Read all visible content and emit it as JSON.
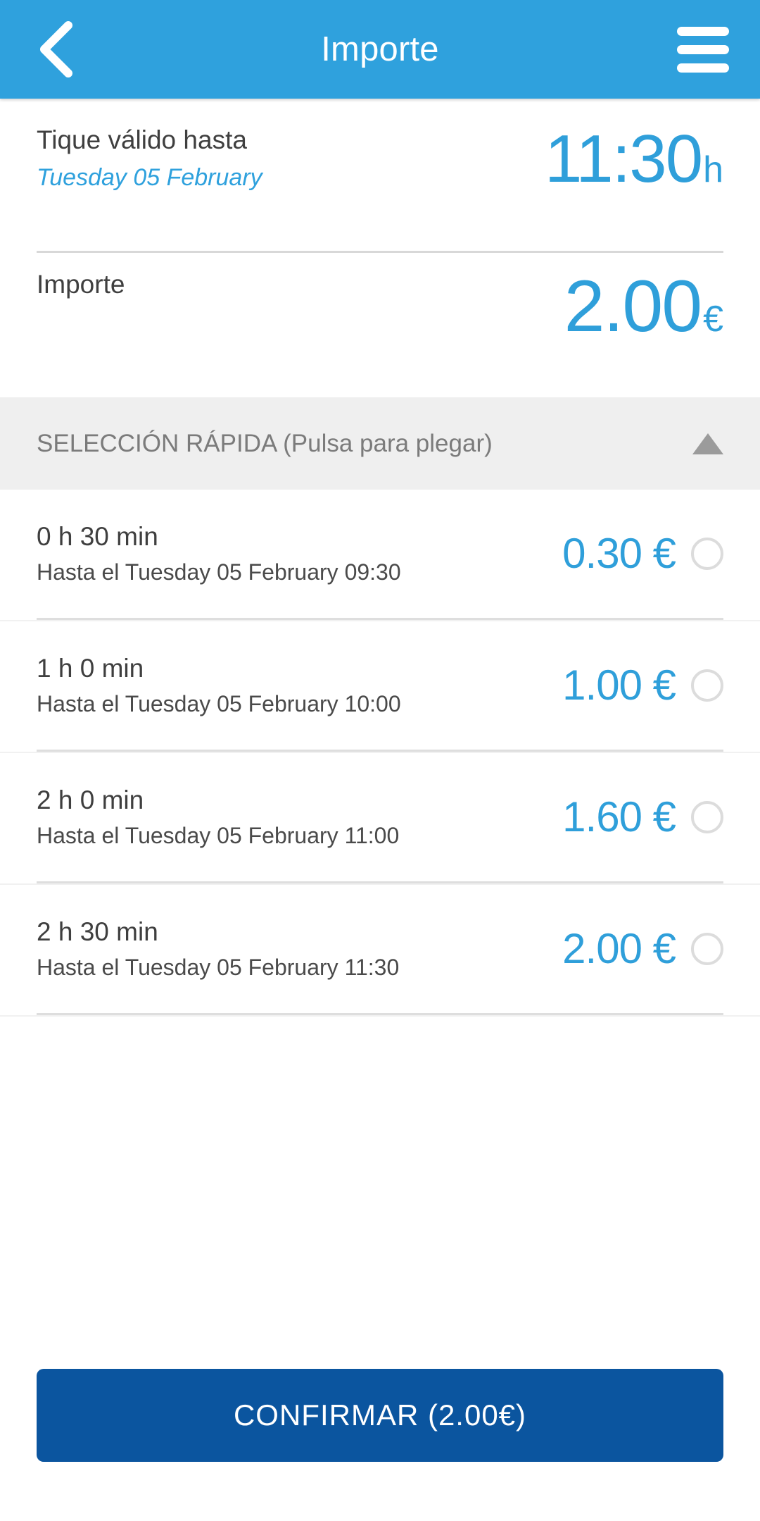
{
  "appbar": {
    "title": "Importe",
    "back_icon": "chevron-left-icon",
    "menu_icon": "hamburger-menu-icon",
    "background_color": "#2fa1dd"
  },
  "summary": {
    "validity": {
      "label": "Tique válido hasta",
      "date": "Tuesday 05 February",
      "time": "11:30",
      "time_unit": "h"
    },
    "amount": {
      "label": "Importe",
      "value": "2.00",
      "currency": "€"
    }
  },
  "quick_select": {
    "header_label": "SELECCIÓN RÁPIDA (Pulsa para plegar)",
    "collapse_icon": "triangle-up-icon",
    "options": [
      {
        "duration": "0 h 30 min",
        "until": "Hasta el Tuesday 05 February 09:30",
        "price": "0.30 €",
        "selected": false
      },
      {
        "duration": "1 h 0 min",
        "until": "Hasta el Tuesday 05 February 10:00",
        "price": "1.00 €",
        "selected": false
      },
      {
        "duration": "2 h 0 min",
        "until": "Hasta el Tuesday 05 February 11:00",
        "price": "1.60 €",
        "selected": false
      },
      {
        "duration": "2 h 30 min",
        "until": "Hasta el Tuesday 05 February 11:30",
        "price": "2.00 €",
        "selected": false
      }
    ]
  },
  "footer": {
    "confirm_label": "CONFIRMAR (2.00€)",
    "confirm_color": "#0b559f"
  },
  "colors": {
    "accent_blue": "#2fa1dd",
    "value_blue": "#2f9fda",
    "button_blue": "#0b559f",
    "section_band": "#efefef",
    "text_dark": "#3f3f3f",
    "text_muted": "#7b7b7b"
  }
}
